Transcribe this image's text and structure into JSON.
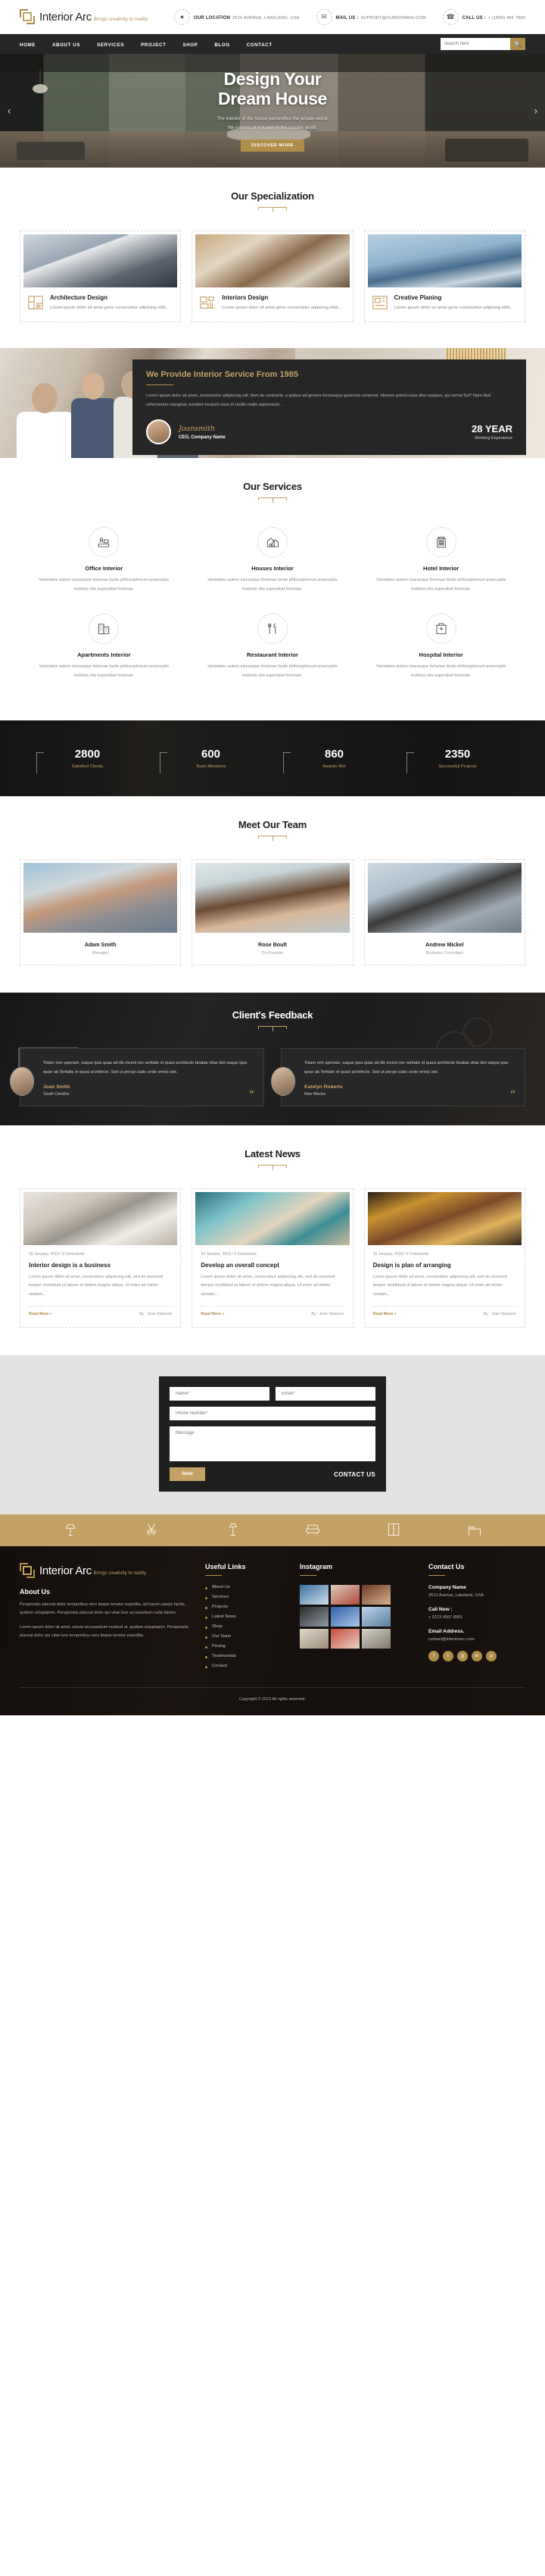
{
  "brand": {
    "name": "Interior Arc",
    "tagline": "Brings creativity to reality"
  },
  "topbar": {
    "items": [
      {
        "icon": "location-pin-icon",
        "label": "OUR LOCATION",
        "value": "2510 AVENUE, LAKELAND, USA"
      },
      {
        "icon": "envelope-icon",
        "label": "MAIL US :",
        "value": "SUPPORT@OURDOMAIN.COM"
      },
      {
        "icon": "phone-icon",
        "label": "CALL US :",
        "value": "+ (1800) 456 7890"
      }
    ]
  },
  "nav": {
    "items": [
      "HOME",
      "ABOUT US",
      "SERVICES",
      "PROJECT",
      "SHOP",
      "BLOG",
      "CONTACT"
    ],
    "search_placeholder": "Search here",
    "search_value": "",
    "search_icon": "search-icon"
  },
  "hero": {
    "title_line1": "Design Your",
    "title_line2": "Dream House",
    "subtitle_line1": "The interior of the house personifies the private world;",
    "subtitle_line2": "the exterior of it is part of the outside world.",
    "cta": "DISCOVER MORE",
    "prev_icon": "chevron-left-icon",
    "next_icon": "chevron-right-icon"
  },
  "specialization": {
    "title": "Our Specialization",
    "cards": [
      {
        "icon": "floor-plan-icon",
        "title": "Architecture Design",
        "text": "Lorem ipsum dolor sit amet gene consectetur adipicing elitd..."
      },
      {
        "icon": "furniture-icon",
        "title": "Interiors Design",
        "text": "Lorem ipsum dolor sit amet gene consectetur adipicing elitd..."
      },
      {
        "icon": "blueprint-icon",
        "title": "Creative Planing",
        "text": "Lorem ipsum dolor sit amet gene consectetur adipicing elitd..."
      }
    ]
  },
  "provide": {
    "title_pre": "We Provide ",
    "title_hl": "Interior Service",
    "title_post": " From 1985",
    "paragraph": "Lorem ipsum dolor sit amet, consectetur adipiscing elit. Item de contrariis, a quibus ad genera formasque generum venerunt. Idemne potest esse dies saepius, qui semel fuit? Nam illud vehementer repugnat, eundem beatum esse et multis malis oppressum. .",
    "signature": "Joansmith",
    "role": "CEO, Company Name",
    "years": "28 YEAR",
    "years_label": "Working Experience"
  },
  "services": {
    "title": "Our Services",
    "body": "Varietates autem iniurasque fortunae facile philosophorum praeceptis instituta vita superabat fortunae.",
    "items": [
      {
        "icon": "office-desk-icon",
        "title": "Office Interior"
      },
      {
        "icon": "house-icon",
        "title": "Houses Interior"
      },
      {
        "icon": "hotel-icon",
        "title": "Hotel Interior"
      },
      {
        "icon": "apartment-icon",
        "title": "Apartments Interior"
      },
      {
        "icon": "restaurant-icon",
        "title": "Restaurant Interior"
      },
      {
        "icon": "hospital-icon",
        "title": "Hospital Interior"
      }
    ]
  },
  "counters": [
    {
      "number": "2800",
      "label": "Satisfied Clients"
    },
    {
      "number": "600",
      "label": "Team Members"
    },
    {
      "number": "860",
      "label": "Awards Win"
    },
    {
      "number": "2350",
      "label": "Successful Projects"
    }
  ],
  "team": {
    "title": "Meet Our Team",
    "members": [
      {
        "name": "Adam Smith",
        "role": "Manager"
      },
      {
        "name": "Rose Boult",
        "role": "Co-Founder"
      },
      {
        "name": "Andrew Mickel",
        "role": "Business Consultant"
      }
    ]
  },
  "feedback": {
    "title": "Client's Feedback",
    "items": [
      {
        "text": "Totam rem aperiam, eaque ipsa quae ab illo invent ore veritatis et quasi architecto beatae vitae dict eaque ipsa quae ab.Teritatis et quasi architecto. Sed ut perspi ciatis unde omnis iste.",
        "name": "Joan Smith",
        "location": "South Carolina",
        "quote_icon": "quote-icon"
      },
      {
        "text": "Totam rem aperiam, eaque ipsa quae ab illo invent ore veritatis et quasi architecto beatae vitae dict eaque ipsa quae ab.Teritatis et quasi architecto. Sed ut perspi ciatis unde omnis iste.",
        "name": "Katelyn Roberts",
        "location": "New Mexico",
        "quote_icon": "quote-icon"
      }
    ]
  },
  "news": {
    "title": "Latest News",
    "posts": [
      {
        "meta": "10 January, 2019 / 3 Comments",
        "title": "Interior design is a business",
        "text": "Lorem ipsum dolor sit amet, consectetur adipiscing elit, sed do eiusmod tempor incididunt ut labore et dolore magna aliqua. Ut enim ad minim veniam...",
        "read_more": "Read More »",
        "author": "By : Joan Simpson"
      },
      {
        "meta": "10 January, 2019 / 0 Comments",
        "title": "Develop an overall concept",
        "text": "Lorem ipsum dolor sit amet, consectetur adipiscing elit, sed do eiusmod tempor incididunt ut labore et dolore magna aliqua. Ut enim ad minim veniam...",
        "read_more": "Read More »",
        "author": "By : Joan Simpson"
      },
      {
        "meta": "10 January, 2019 / 0 Comments",
        "title": "Design is plan of arranging",
        "text": "Lorem ipsum dolor sit amet, consectetur adipiscing elit, sed do eiusmod tempor incididunt ut labore et dolore magna aliqua. Ut enim ad minim veniam...",
        "read_more": "Read More »",
        "author": "By : Joan Simpson"
      }
    ]
  },
  "contact_form": {
    "name_placeholder": "Name*",
    "email_placeholder": "Email*",
    "phone_placeholder": "Phone Number*",
    "message_placeholder": "Message",
    "submit": "Send",
    "heading": "CONTACT US"
  },
  "strip_icons": [
    "lamp-icon",
    "chair-icon",
    "floor-lamp-icon",
    "sofa-icon",
    "cabinet-icon",
    "bed-icon"
  ],
  "footer": {
    "about_heading": "About Us",
    "about_p1": "Perspiciatis placeat dolor temporibus vero itaque tenetur expedita, ad harum saepe facilis, quidem voluptatem. Perspiciatis placeat dolor qui vitae lure accusantium nulla labore.",
    "about_p2": "Lorem ipsum dolor sit amet, soluta accusantium nostrud ai, quidem voluptatem. Perspiciatis placeat dolor qui vitae lure temporibus vero itaque tenetur expedita.",
    "links_heading": "Useful Links",
    "links": [
      "About Us",
      "Services",
      "Projects",
      "Latest News",
      "Shop",
      "Our Team",
      "Pricing",
      "Testimonials",
      "Contact"
    ],
    "instagram_heading": "Instagram",
    "contact_heading": "Contact Us",
    "company_label": "Company Name",
    "company_value": "2510 Avenue, Lakeland, USA",
    "call_label": "Call Now :",
    "call_value": "+ 0123 4567 8901",
    "email_label": "Email Address.",
    "email_value": "contact@interiorarc.com",
    "socials": [
      "facebook-icon",
      "twitter-icon",
      "google-plus-icon",
      "linkedin-icon",
      "pinterest-icon"
    ],
    "copyright_pre": "Copyright © 2019 All rights reserved."
  }
}
